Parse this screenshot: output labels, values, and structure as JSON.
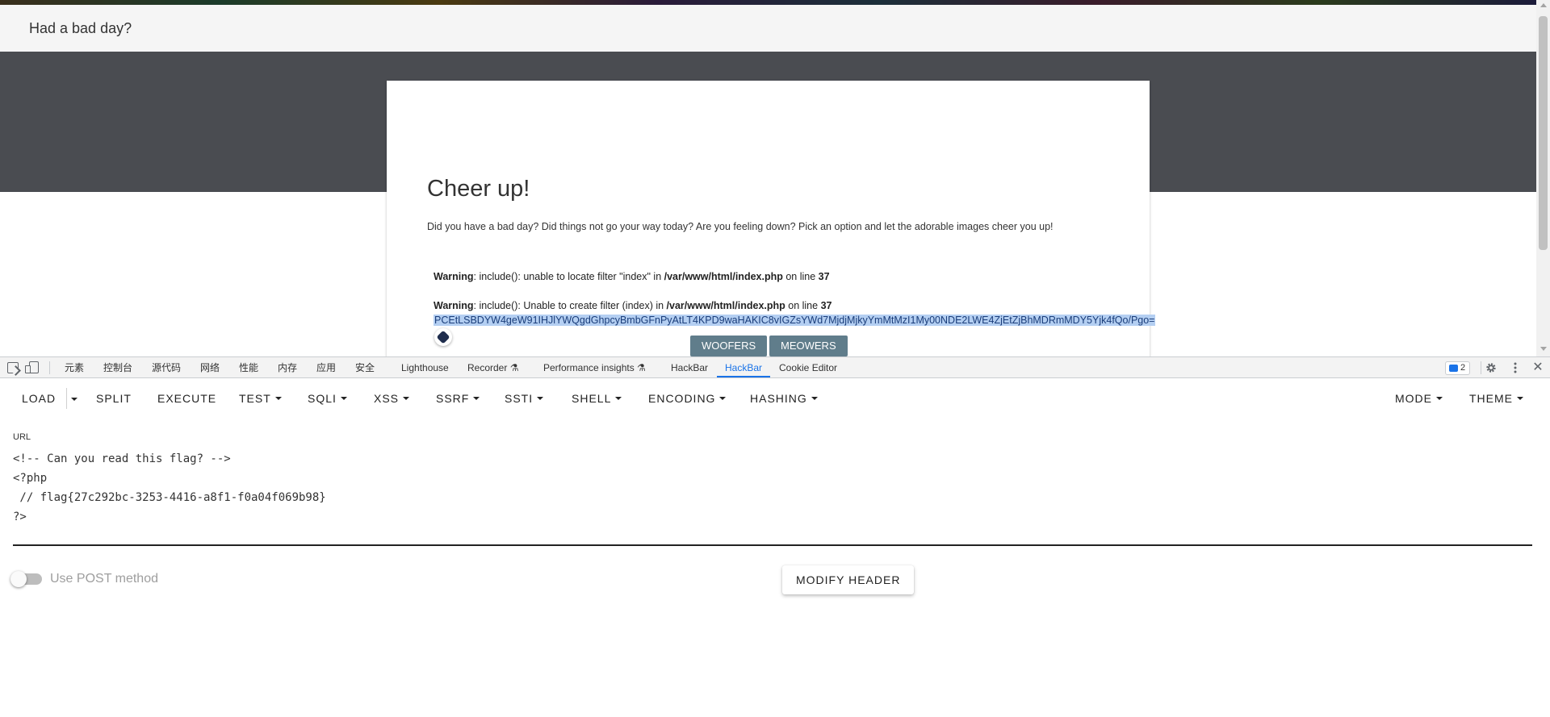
{
  "page": {
    "navbar_brand": "Had a bad day?",
    "card": {
      "title": "Cheer up!",
      "text": "Did you have a bad day? Did things not go your way today? Are you feeling down? Pick an option and let the adorable images cheer you up!",
      "warning_1": {
        "label": "Warning",
        "message": ": include(): unable to locate filter \"index\" in ",
        "path": "/var/www/html/index.php",
        "on_line": " on line ",
        "line": "37"
      },
      "warning_2": {
        "label": "Warning",
        "message": ": include(): Unable to create filter (index) in ",
        "path": "/var/www/html/index.php",
        "on_line": " on line ",
        "line": "37"
      },
      "base64_output": "PCEtLSBDYW4geW91IHJlYWQgdGhpcyBmbGFnPyAtLT4KPD9waHAKIC8vIGZsYWd7MjdjMjkyYmMtMzI1My00NDE2LWE4ZjEtZjBhMDRmMDY5Yjk4fQo/Pgo=",
      "buttons": {
        "woofers": "WOOFERS",
        "meowers": "MEOWERS"
      }
    }
  },
  "devtools": {
    "tabs": [
      "元素",
      "控制台",
      "源代码",
      "网络",
      "性能",
      "内存",
      "应用",
      "安全",
      "Lighthouse",
      "Recorder ⚗",
      "Performance insights ⚗",
      "HackBar",
      "HackBar",
      "Cookie Editor"
    ],
    "active_tab_index": 12,
    "issues_count": "2"
  },
  "hackbar": {
    "toolbar": {
      "load": "LOAD",
      "split": "SPLIT",
      "execute": "EXECUTE",
      "test": "TEST",
      "sqli": "SQLI",
      "xss": "XSS",
      "ssrf": "SSRF",
      "ssti": "SSTI",
      "shell": "SHELL",
      "encoding": "ENCODING",
      "hashing": "HASHING",
      "mode": "MODE",
      "theme": "THEME"
    },
    "url_label": "URL",
    "url_value": "<!-- Can you read this flag? -->\n<?php\n // flag{27c292bc-3253-4416-a8f1-f0a04f069b98}\n?>",
    "post_method_label": "Use POST method",
    "post_method_enabled": false,
    "modify_header": "MODIFY HEADER"
  },
  "colors": {
    "accent": "#1a73e8",
    "hero_dark": "#4a4c51",
    "pick_button": "#607d8b",
    "selection": "#b4cff2"
  }
}
